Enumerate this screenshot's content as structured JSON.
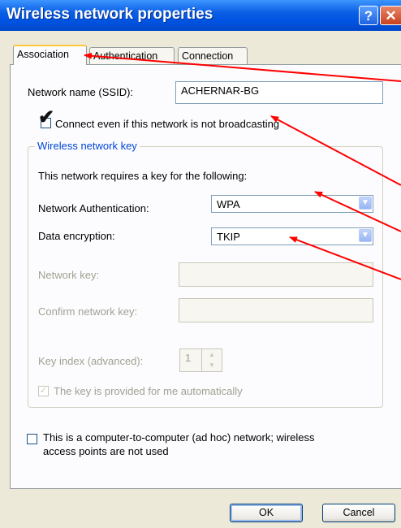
{
  "window": {
    "title": "Wireless network properties",
    "help_label": "?",
    "close_label": "✕"
  },
  "tabs": [
    {
      "label": "Association",
      "active": true
    },
    {
      "label": "Authentication",
      "active": false
    },
    {
      "label": "Connection",
      "active": false
    }
  ],
  "ssid": {
    "label": "Network name (SSID):",
    "value": "ACHERNAR-BG"
  },
  "broadcast_checkbox": {
    "label": "Connect even if this network is not broadcasting",
    "checked": true,
    "mark": "✔"
  },
  "key_group": {
    "title": "Wireless network key",
    "description": "This network requires a key for the following:",
    "auth_label": "Network Authentication:",
    "auth_value": "WPA",
    "encryption_label": "Data encryption:",
    "encryption_value": "TKIP",
    "network_key_label": "Network key:",
    "network_key_value": "",
    "confirm_key_label": "Confirm network key:",
    "confirm_key_value": "",
    "key_index_label": "Key index (advanced):",
    "key_index_value": "1",
    "auto_key_label": "The key is provided for me automatically",
    "auto_key_checked": true,
    "auto_key_mark": "✓"
  },
  "adhoc": {
    "label_line1": "This is a computer-to-computer (ad hoc) network; wireless",
    "label_line2": "access points are not used",
    "checked": false
  },
  "buttons": {
    "ok": "OK",
    "cancel": "Cancel"
  },
  "icons": {
    "dropdown": "▼",
    "spin_up": "▲",
    "spin_down": "▼"
  },
  "colors": {
    "annotation_arrow": "#ff0000",
    "titlebar": "#0053e1",
    "tab_highlight": "#ffc73c",
    "group_title": "#0046d5"
  }
}
